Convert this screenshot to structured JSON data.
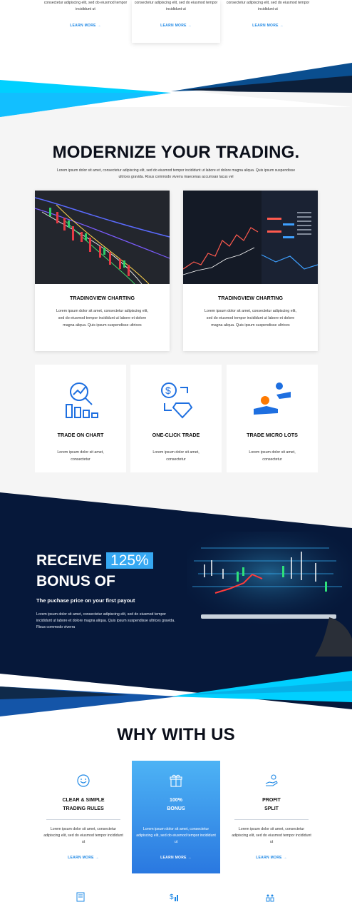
{
  "services": [
    {
      "text": "consectetur adipiscing elit, sed do eiusmod tempor incididunt ut",
      "link": "LEARN MORE"
    },
    {
      "text": "consectetur adipiscing elit, sed do eiusmod tempor incididunt ut",
      "link": "LEARN MORE"
    },
    {
      "text": "consectetur adipiscing elit, sed do eiusmod tempor incididunt ut",
      "link": "LEARN MORE"
    }
  ],
  "modernize": {
    "title": "MODERNIZE YOUR TRADING.",
    "subtitle": "Lorem ipsum dolor sit amet, consectetur adipiscing elit, sed do eiusmod tempor incididunt ut labore et dolore magna aliqua. Quis ipsum suspendisse ultrices gravida. Risus commodo viverra maecenas accumsan lacus vel",
    "cards": [
      {
        "title": "TRADINGVIEW CHARTING",
        "text": "Lorem ipsum dolor sit amet, consectetur adipiscing elit, sed do eiusmod tempor incididunt ut labore et dolore magna aliqua. Quis ipsum suspendisse ultrices"
      },
      {
        "title": "TRADINGVIEW CHARTING",
        "text": "Lorem ipsum dolor sit amet, consectetur adipiscing elit, sed do eiusmod tempor incididunt ut labore et dolore magna aliqua. Quis ipsum suspendisse ultrices"
      }
    ]
  },
  "features": [
    {
      "title": "TRADE ON CHART",
      "text": "Lorem ipsum dolor sit amet, consectetur",
      "icon": "chart-analysis-icon"
    },
    {
      "title": "ONE-CLICK TRADE",
      "text": "Lorem ipsum dolor sit amet, consectetur",
      "icon": "dollar-diamond-exchange-icon"
    },
    {
      "title": "TRADE MICRO LOTS",
      "text": "Lorem ipsum dolor sit amet, consectetur",
      "icon": "hands-coins-icon"
    }
  ],
  "bonus": {
    "line1": "RECEIVE",
    "highlight": "125%",
    "line2": "BONUS OF",
    "subtitle": "The puchase price on your first payout",
    "text": "Lorem ipsum dolor sit amet, consectetur adipiscing elit, sed do eiusmod tempor incididunt ut labore et dolore magna aliqua. Quis ipsum suspendisse ultrices gravida. Risus commodo viverra"
  },
  "why": {
    "title": "WHY WITH US",
    "cards": [
      {
        "title1": "CLEAR & SIMPLE",
        "title2": "TRADING RULES",
        "text": "Lorem ipsum dolor sit amet, consectetur adipiscing elit, sed do eiusmod tempor incididunt ut",
        "link": "LEARN MORE",
        "icon": "smile-face-icon"
      },
      {
        "title1": "100%",
        "title2": "BONUS",
        "text": "Lorem ipsum dolor sit amet, consectetur adipiscing elit, sed do eiusmod tempor incididunt ut",
        "link": "LEARN MORE",
        "icon": "gift-icon"
      },
      {
        "title1": "PROFIT",
        "title2": "SPLIT",
        "text": "Lorem ipsum dolor sit amet, consectetur adipiscing elit, sed do eiusmod tempor incididunt ut",
        "link": "LEARN MORE",
        "icon": "hand-money-icon"
      }
    ]
  },
  "colors": {
    "accent": "#1e88e5",
    "dark": "#06183a",
    "cyan": "#00d0ff",
    "highlight": "#36a8f2"
  }
}
